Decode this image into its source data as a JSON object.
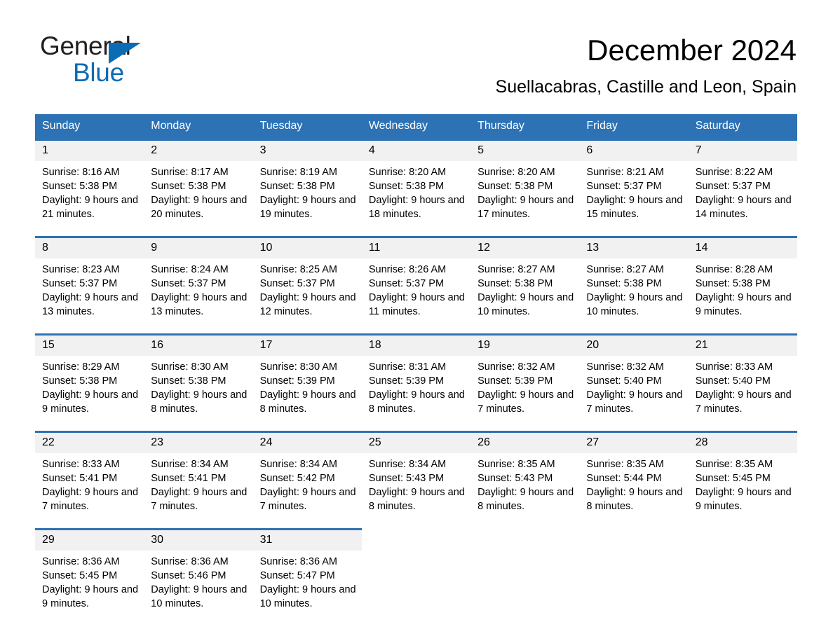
{
  "logo": {
    "line1": "General",
    "line2": "Blue",
    "triangle_color": "#0b6cb5"
  },
  "header": {
    "month_title": "December 2024",
    "location": "Suellacabras, Castille and Leon, Spain"
  },
  "colors": {
    "header_blue": "#2d72b4",
    "daynum_band": "#f1f1f1",
    "text": "#000000",
    "header_text": "#ffffff"
  },
  "weekday_headers": [
    "Sunday",
    "Monday",
    "Tuesday",
    "Wednesday",
    "Thursday",
    "Friday",
    "Saturday"
  ],
  "weeks": [
    {
      "days": [
        {
          "date": "1",
          "sunrise": "Sunrise: 8:16 AM",
          "sunset": "Sunset: 5:38 PM",
          "daylight": "Daylight: 9 hours and 21 minutes."
        },
        {
          "date": "2",
          "sunrise": "Sunrise: 8:17 AM",
          "sunset": "Sunset: 5:38 PM",
          "daylight": "Daylight: 9 hours and 20 minutes."
        },
        {
          "date": "3",
          "sunrise": "Sunrise: 8:19 AM",
          "sunset": "Sunset: 5:38 PM",
          "daylight": "Daylight: 9 hours and 19 minutes."
        },
        {
          "date": "4",
          "sunrise": "Sunrise: 8:20 AM",
          "sunset": "Sunset: 5:38 PM",
          "daylight": "Daylight: 9 hours and 18 minutes."
        },
        {
          "date": "5",
          "sunrise": "Sunrise: 8:20 AM",
          "sunset": "Sunset: 5:38 PM",
          "daylight": "Daylight: 9 hours and 17 minutes."
        },
        {
          "date": "6",
          "sunrise": "Sunrise: 8:21 AM",
          "sunset": "Sunset: 5:37 PM",
          "daylight": "Daylight: 9 hours and 15 minutes."
        },
        {
          "date": "7",
          "sunrise": "Sunrise: 8:22 AM",
          "sunset": "Sunset: 5:37 PM",
          "daylight": "Daylight: 9 hours and 14 minutes."
        }
      ]
    },
    {
      "days": [
        {
          "date": "8",
          "sunrise": "Sunrise: 8:23 AM",
          "sunset": "Sunset: 5:37 PM",
          "daylight": "Daylight: 9 hours and 13 minutes."
        },
        {
          "date": "9",
          "sunrise": "Sunrise: 8:24 AM",
          "sunset": "Sunset: 5:37 PM",
          "daylight": "Daylight: 9 hours and 13 minutes."
        },
        {
          "date": "10",
          "sunrise": "Sunrise: 8:25 AM",
          "sunset": "Sunset: 5:37 PM",
          "daylight": "Daylight: 9 hours and 12 minutes."
        },
        {
          "date": "11",
          "sunrise": "Sunrise: 8:26 AM",
          "sunset": "Sunset: 5:37 PM",
          "daylight": "Daylight: 9 hours and 11 minutes."
        },
        {
          "date": "12",
          "sunrise": "Sunrise: 8:27 AM",
          "sunset": "Sunset: 5:38 PM",
          "daylight": "Daylight: 9 hours and 10 minutes."
        },
        {
          "date": "13",
          "sunrise": "Sunrise: 8:27 AM",
          "sunset": "Sunset: 5:38 PM",
          "daylight": "Daylight: 9 hours and 10 minutes."
        },
        {
          "date": "14",
          "sunrise": "Sunrise: 8:28 AM",
          "sunset": "Sunset: 5:38 PM",
          "daylight": "Daylight: 9 hours and 9 minutes."
        }
      ]
    },
    {
      "days": [
        {
          "date": "15",
          "sunrise": "Sunrise: 8:29 AM",
          "sunset": "Sunset: 5:38 PM",
          "daylight": "Daylight: 9 hours and 9 minutes."
        },
        {
          "date": "16",
          "sunrise": "Sunrise: 8:30 AM",
          "sunset": "Sunset: 5:38 PM",
          "daylight": "Daylight: 9 hours and 8 minutes."
        },
        {
          "date": "17",
          "sunrise": "Sunrise: 8:30 AM",
          "sunset": "Sunset: 5:39 PM",
          "daylight": "Daylight: 9 hours and 8 minutes."
        },
        {
          "date": "18",
          "sunrise": "Sunrise: 8:31 AM",
          "sunset": "Sunset: 5:39 PM",
          "daylight": "Daylight: 9 hours and 8 minutes."
        },
        {
          "date": "19",
          "sunrise": "Sunrise: 8:32 AM",
          "sunset": "Sunset: 5:39 PM",
          "daylight": "Daylight: 9 hours and 7 minutes."
        },
        {
          "date": "20",
          "sunrise": "Sunrise: 8:32 AM",
          "sunset": "Sunset: 5:40 PM",
          "daylight": "Daylight: 9 hours and 7 minutes."
        },
        {
          "date": "21",
          "sunrise": "Sunrise: 8:33 AM",
          "sunset": "Sunset: 5:40 PM",
          "daylight": "Daylight: 9 hours and 7 minutes."
        }
      ]
    },
    {
      "days": [
        {
          "date": "22",
          "sunrise": "Sunrise: 8:33 AM",
          "sunset": "Sunset: 5:41 PM",
          "daylight": "Daylight: 9 hours and 7 minutes."
        },
        {
          "date": "23",
          "sunrise": "Sunrise: 8:34 AM",
          "sunset": "Sunset: 5:41 PM",
          "daylight": "Daylight: 9 hours and 7 minutes."
        },
        {
          "date": "24",
          "sunrise": "Sunrise: 8:34 AM",
          "sunset": "Sunset: 5:42 PM",
          "daylight": "Daylight: 9 hours and 7 minutes."
        },
        {
          "date": "25",
          "sunrise": "Sunrise: 8:34 AM",
          "sunset": "Sunset: 5:43 PM",
          "daylight": "Daylight: 9 hours and 8 minutes."
        },
        {
          "date": "26",
          "sunrise": "Sunrise: 8:35 AM",
          "sunset": "Sunset: 5:43 PM",
          "daylight": "Daylight: 9 hours and 8 minutes."
        },
        {
          "date": "27",
          "sunrise": "Sunrise: 8:35 AM",
          "sunset": "Sunset: 5:44 PM",
          "daylight": "Daylight: 9 hours and 8 minutes."
        },
        {
          "date": "28",
          "sunrise": "Sunrise: 8:35 AM",
          "sunset": "Sunset: 5:45 PM",
          "daylight": "Daylight: 9 hours and 9 minutes."
        }
      ]
    },
    {
      "days": [
        {
          "date": "29",
          "sunrise": "Sunrise: 8:36 AM",
          "sunset": "Sunset: 5:45 PM",
          "daylight": "Daylight: 9 hours and 9 minutes."
        },
        {
          "date": "30",
          "sunrise": "Sunrise: 8:36 AM",
          "sunset": "Sunset: 5:46 PM",
          "daylight": "Daylight: 9 hours and 10 minutes."
        },
        {
          "date": "31",
          "sunrise": "Sunrise: 8:36 AM",
          "sunset": "Sunset: 5:47 PM",
          "daylight": "Daylight: 9 hours and 10 minutes."
        },
        {
          "date": "",
          "sunrise": "",
          "sunset": "",
          "daylight": ""
        },
        {
          "date": "",
          "sunrise": "",
          "sunset": "",
          "daylight": ""
        },
        {
          "date": "",
          "sunrise": "",
          "sunset": "",
          "daylight": ""
        },
        {
          "date": "",
          "sunrise": "",
          "sunset": "",
          "daylight": ""
        }
      ]
    }
  ]
}
